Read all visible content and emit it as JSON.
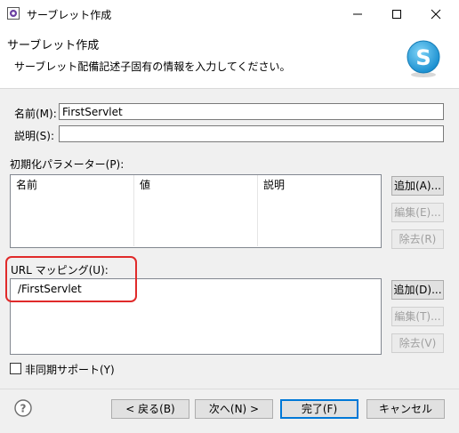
{
  "window": {
    "title": "サーブレット作成",
    "icons": [
      "app-icon",
      "minimize-icon",
      "maximize-icon",
      "close-icon"
    ]
  },
  "banner": {
    "title": "サーブレット作成",
    "description": "サーブレット配備記述子固有の情報を入力してください。",
    "logo_icon": "servlet-s-logo-icon",
    "logo_letter": "S"
  },
  "form": {
    "name_label": "名前(M):",
    "name_value": "FirstServlet",
    "description_label": "説明(S):",
    "description_value": ""
  },
  "init_params": {
    "label": "初期化パラメーター(P):",
    "columns": [
      "名前",
      "値",
      "説明"
    ],
    "rows": [],
    "buttons": {
      "add": "追加(A)...",
      "edit": "編集(E)...",
      "remove": "除去(R)"
    }
  },
  "url_mappings": {
    "label": "URL マッピング(U):",
    "items": [
      "/FirstServlet"
    ],
    "buttons": {
      "add": "追加(D)...",
      "edit": "編集(T)...",
      "remove": "除去(V)"
    }
  },
  "async": {
    "label": "非同期サポート(Y)",
    "checked": false
  },
  "footer": {
    "help_icon": "help-icon",
    "back": "< 戻る(B)",
    "next": "次へ(N) >",
    "finish": "完了(F)",
    "cancel": "キャンセル"
  },
  "colors": {
    "highlight": "#e02a2a",
    "default_button_border": "#0078d7",
    "logo": "#1fa0e0"
  }
}
